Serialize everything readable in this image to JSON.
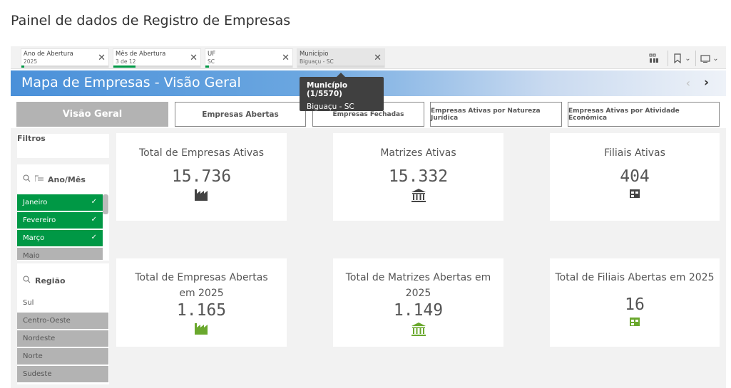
{
  "app": {
    "title": "Painel de dados de Registro de Empresas"
  },
  "selections": [
    {
      "label": "Ano de Abertura",
      "value": "2025",
      "progress": 0.03
    },
    {
      "label": "Mês de Abertura",
      "value": "3 de 12",
      "progress": 0.25
    },
    {
      "label": "UF",
      "value": "SC",
      "progress": 0.04
    },
    {
      "label": "Município",
      "value": "Biguaçu - SC",
      "progress": 0.0
    }
  ],
  "sheet": {
    "title": "Mapa de Empresas - Visão Geral"
  },
  "tooltip": {
    "title": "Município (1/5570)",
    "value": "Biguaçu - SC"
  },
  "tabs": [
    {
      "label": "Visão Geral"
    },
    {
      "label": "Empresas Abertas"
    },
    {
      "label": "Empresas Fechadas"
    },
    {
      "label": "Empresas Ativas por Natureza Jurídica"
    },
    {
      "label": "Empresas Ativas por Atividade Econômica"
    }
  ],
  "filters": {
    "title": "Filtros",
    "ano_mes": {
      "label": "Ano/Mês",
      "items": [
        {
          "label": "Janeiro",
          "selected": true
        },
        {
          "label": "Fevereiro",
          "selected": true
        },
        {
          "label": "Março",
          "selected": true
        },
        {
          "label": "Maio",
          "selected": false
        }
      ]
    },
    "regiao": {
      "label": "Região",
      "items": [
        {
          "label": "Sul",
          "state": "possible"
        },
        {
          "label": "Centro-Oeste",
          "state": "excluded"
        },
        {
          "label": "Nordeste",
          "state": "excluded"
        },
        {
          "label": "Norte",
          "state": "excluded"
        },
        {
          "label": "Sudeste",
          "state": "excluded"
        }
      ]
    }
  },
  "kpis": [
    {
      "title": "Total de Empresas Ativas",
      "value": "15.736",
      "icon": "factory-icon"
    },
    {
      "title": "Matrizes Ativas",
      "value": "15.332",
      "icon": "bank-icon"
    },
    {
      "title": "Filiais Ativas",
      "value": "404",
      "icon": "branch-icon"
    },
    {
      "title": "Total de Empresas Abertas em 2025",
      "value": "1.165",
      "icon": "factory-icon"
    },
    {
      "title": "Total de Matrizes Abertas em 2025",
      "value": "1.149",
      "icon": "bank-icon"
    },
    {
      "title": "Total de Filiais Abertas em 2025",
      "value": "16",
      "icon": "branch-icon"
    }
  ],
  "colors": {
    "selected": "#009845",
    "excluded": "#b3b3b3",
    "icon_dark": "#444444",
    "icon_green": "#6aa82d"
  }
}
